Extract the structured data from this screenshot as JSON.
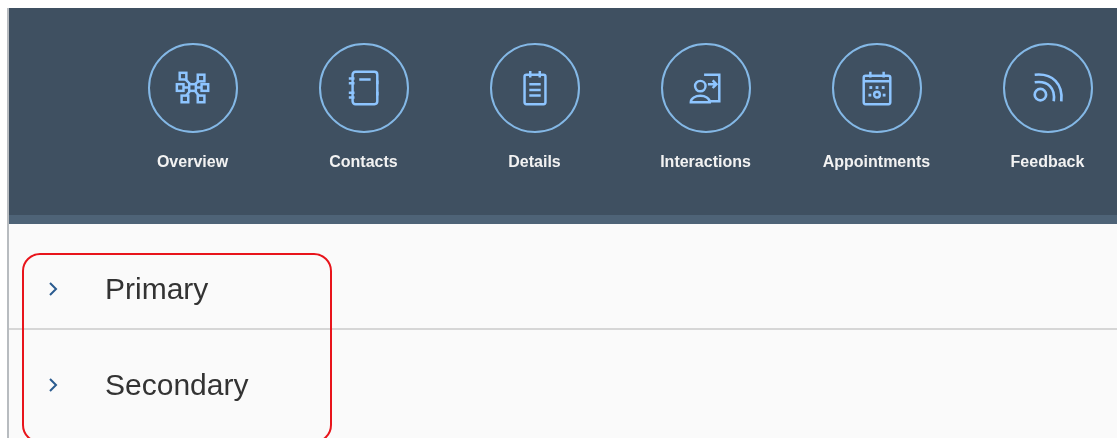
{
  "nav": [
    {
      "label": "Overview",
      "kind": "network"
    },
    {
      "label": "Contacts",
      "kind": "notebook"
    },
    {
      "label": "Details",
      "kind": "clipboard"
    },
    {
      "label": "Interactions",
      "kind": "person-arrow"
    },
    {
      "label": "Appointments",
      "kind": "calendar"
    },
    {
      "label": "Feedback",
      "kind": "signal"
    }
  ],
  "sections": [
    {
      "label": "Primary",
      "expanded": false
    },
    {
      "label": "Secondary",
      "expanded": false
    }
  ],
  "highlight": {
    "color": "#e8141b"
  }
}
